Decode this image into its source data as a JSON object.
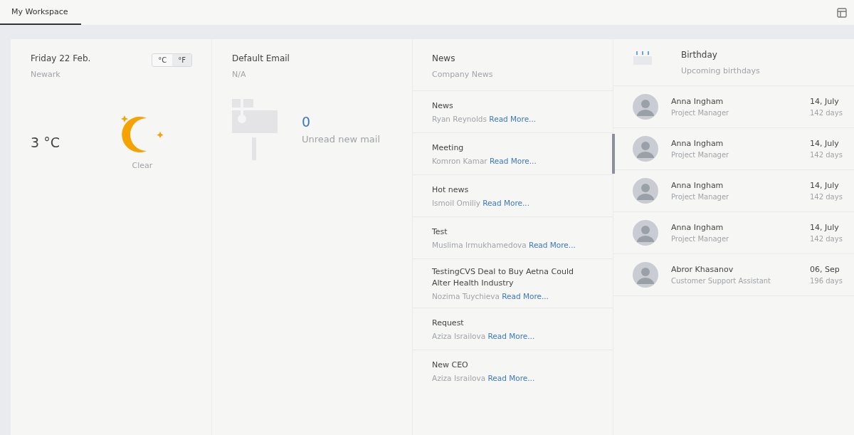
{
  "tabs": [
    {
      "label": "My Workspace",
      "selected": true
    }
  ],
  "weather": {
    "date": "Friday 22 Feb.",
    "city": "Newark",
    "units": [
      {
        "label": "°C",
        "selected": false
      },
      {
        "label": "°F",
        "selected": true
      }
    ],
    "temperature": "3 °C",
    "condition": "Clear"
  },
  "email": {
    "title": "Default Email",
    "address": "N/A",
    "count": "0",
    "label": "Unread new mail"
  },
  "news": {
    "title": "News",
    "subtitle": "Company News",
    "items": [
      {
        "title": "News",
        "author": "Ryan Reynolds",
        "link": "Read More..."
      },
      {
        "title": "Meeting",
        "author": "Komron Kamar",
        "link": "Read More..."
      },
      {
        "title": "Hot news",
        "author": "Ismoil Omiliy",
        "link": "Read More..."
      },
      {
        "title": "Test",
        "author": "Muslima Irmukhamedova",
        "link": "Read More..."
      },
      {
        "title": "TestingCVS Deal to Buy Aetna Could Alter Health Industry",
        "author": "Nozima Tuychieva",
        "link": "Read More..."
      },
      {
        "title": "Request",
        "author": "Aziza Israilova",
        "link": "Read More..."
      },
      {
        "title": "New CEO",
        "author": "Aziza Israilova",
        "link": "Read More..."
      }
    ]
  },
  "birthday": {
    "title": "Birthday",
    "subtitle": "Upcoming birthdays",
    "people": [
      {
        "name": "Anna Ingham",
        "role": "Project Manager",
        "date": "14, July",
        "days": "142 days"
      },
      {
        "name": "Anna Ingham",
        "role": "Project Manager",
        "date": "14, July",
        "days": "142 days"
      },
      {
        "name": "Anna Ingham",
        "role": "Project Manager",
        "date": "14, July",
        "days": "142 days"
      },
      {
        "name": "Anna Ingham",
        "role": "Project Manager",
        "date": "14, July",
        "days": "142 days"
      },
      {
        "name": "Abror Khasanov",
        "role": "Customer Support Assistant",
        "date": "06, Sep",
        "days": "196 days"
      }
    ]
  }
}
